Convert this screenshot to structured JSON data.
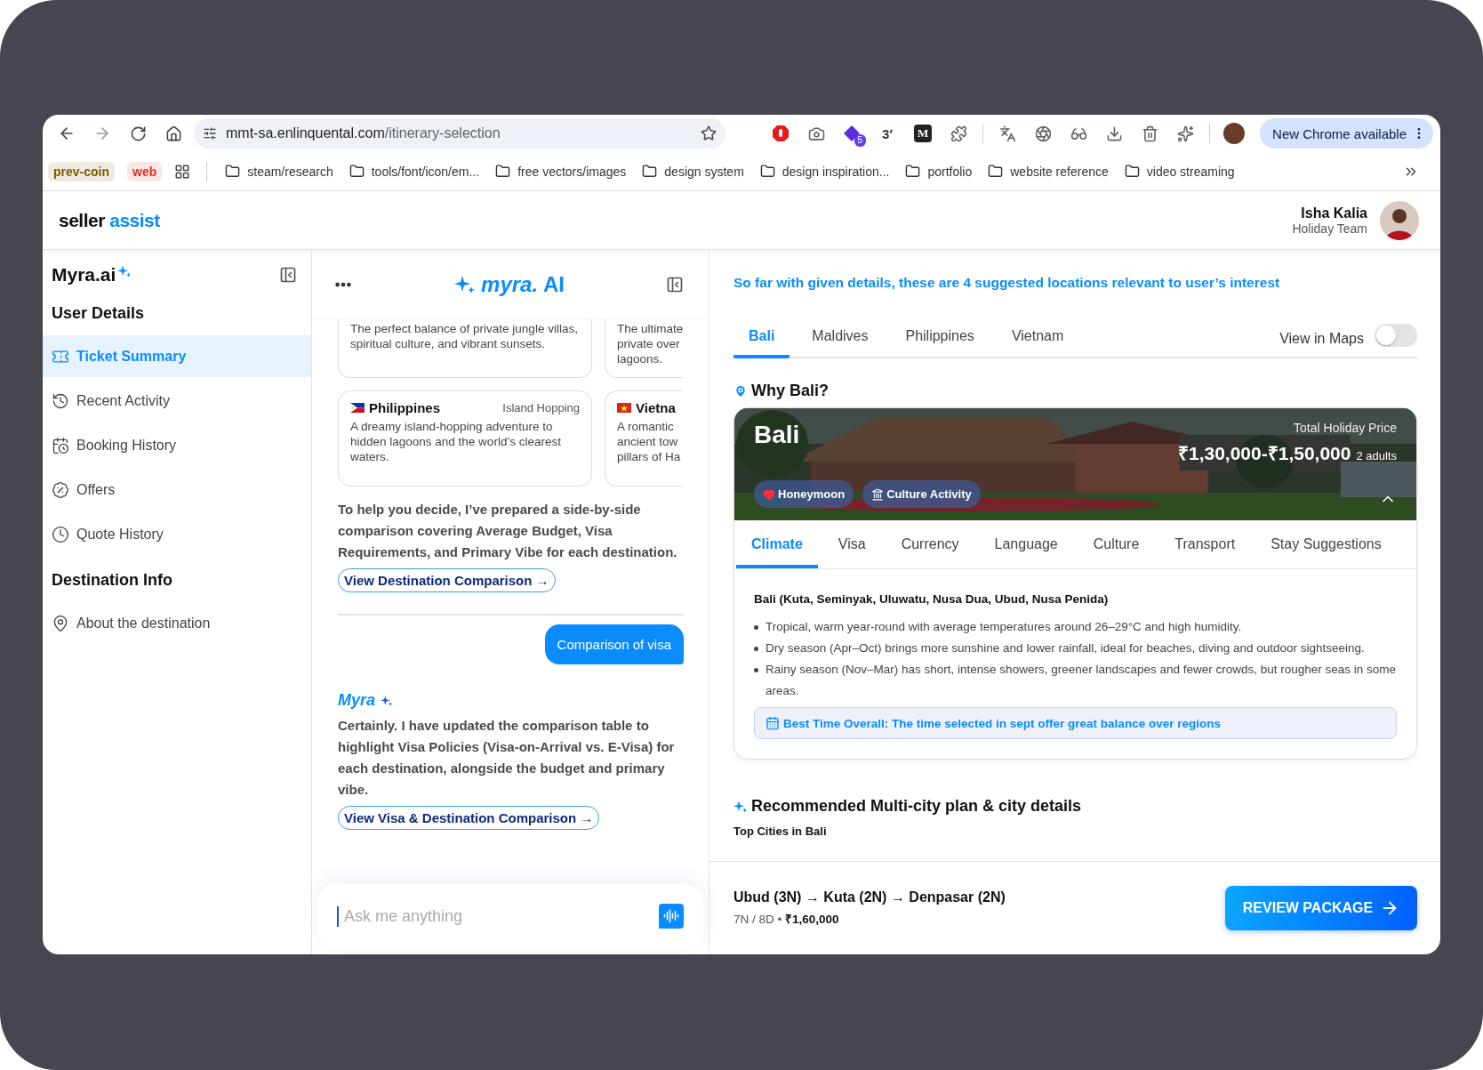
{
  "browser": {
    "url_host": "mmt-sa.enlinquental.com",
    "url_path": "/itinerary-selection",
    "extension_badge": "5",
    "extension_text": "3′",
    "extension_letter": "M",
    "update_button": "New Chrome available",
    "bookmark_chips": [
      {
        "label": "prev-coin",
        "color": "#7a5c00"
      },
      {
        "label": "web",
        "color": "#d93025"
      }
    ],
    "bookmarks": [
      "steam/research",
      "tools/font/icon/em...",
      "free vectors/images",
      "design system",
      "design inspiration...",
      "portfolio",
      "website reference",
      "video streaming"
    ]
  },
  "header": {
    "logo_main": "seller",
    "logo_accent": "assist",
    "user_name": "Isha Kalia",
    "user_team": "Holiday Team"
  },
  "sidebar": {
    "title": "Myra.ai",
    "sections": [
      {
        "title": "User Details",
        "items": [
          {
            "label": "Ticket Summary",
            "selected": true
          },
          {
            "label": "Recent Activity",
            "selected": false
          },
          {
            "label": "Booking History",
            "selected": false
          },
          {
            "label": "Offers",
            "selected": false
          },
          {
            "label": "Quote History",
            "selected": false
          }
        ]
      },
      {
        "title": "Destination Info",
        "items": [
          {
            "label": "About the destination",
            "selected": false
          }
        ]
      }
    ]
  },
  "chat": {
    "logo": "*myra.* AI",
    "card_rows": [
      [
        {
          "kind": "cut-top",
          "description": "The perfect balance of private jungle villas, spiritual culture, and vibrant sunsets."
        },
        {
          "kind": "cut-top-right",
          "description": "The ultimate\nprivate over\nlagoons."
        }
      ],
      [
        {
          "kind": "full",
          "name": "Philippines",
          "tag": "Island Hopping",
          "description": "A dreamy island-hopping adventure to hidden lagoons and the world’s clearest waters."
        },
        {
          "kind": "cut-right",
          "name": "Vietna",
          "description": "A romantic\nancient tow\npillars of Ha"
        }
      ]
    ],
    "messages": [
      {
        "kind": "bot",
        "text": "To help you decide, I’ve prepared a side-by-side comparison covering Average Budget, Visa Requirements, and Primary Vibe for each destination.",
        "link": "View Destination Comparison →"
      },
      {
        "kind": "user",
        "text": "Comparison of visa"
      },
      {
        "kind": "bot",
        "author": "Myra",
        "text": "Certainly. I have updated the comparison table to highlight Visa Policies (Visa-on-Arrival vs. E-Visa) for each destination, alongside the budget and primary vibe.",
        "link": "View Visa & Destination Comparison →"
      }
    ],
    "input": {
      "placeholder": "Ask me anything"
    }
  },
  "details": {
    "intro": "So far with given details, these are 4 suggested locations relevant to user’s interest",
    "destination_tabs": [
      {
        "label": "Bali",
        "selected": true
      },
      {
        "label": "Maldives",
        "selected": false
      },
      {
        "label": "Philippines",
        "selected": false
      },
      {
        "label": "Vietnam",
        "selected": false
      }
    ],
    "maps_toggle": {
      "label": "View in Maps",
      "on": false
    },
    "why_title": "Why Bali?",
    "hero": {
      "kind": "picture",
      "name": "Bali",
      "tags": [
        {
          "label": "Honeymoon"
        },
        {
          "label": "Culture Activity"
        }
      ],
      "price_label": "Total Holiday Price",
      "price": "₹1,30,000-₹1,50,000",
      "pax": "2 adults"
    },
    "info_tabs": [
      {
        "label": "Climate",
        "selected": true
      },
      {
        "label": "Visa",
        "selected": false
      },
      {
        "label": "Currency",
        "selected": false
      },
      {
        "label": "Language",
        "selected": false
      },
      {
        "label": "Culture",
        "selected": false
      },
      {
        "label": "Transport",
        "selected": false
      },
      {
        "label": "Stay Suggestions",
        "selected": false
      }
    ],
    "climate": {
      "heading": "Bali (Kuta, Seminyak, Uluwatu, Nusa Dua, Ubud, Nusa Penida)",
      "bullets": [
        "Tropical, warm year-round with average temperatures around 26–29°C and high humidity.",
        "Dry season (Apr–Oct) brings more sunshine and lower rainfall, ideal for beaches, diving and outdoor sightseeing.",
        "Rainy season (Nov–Mar) has short, intense showers, greener landscapes and fewer crowds, but rougher seas in some areas."
      ],
      "note": "Best Time Overall: The time selected in sept offer great balance over regions"
    },
    "plan_title": "Recommended Multi-city plan & city details",
    "plan_subtitle": "Top Cities in Bali"
  },
  "footer": {
    "route": "Ubud (3N) → Kuta (2N) → Denpasar (2N)",
    "meta": "7N / 8D • **₹1,60,000**",
    "button": "REVIEW PACKAGE"
  }
}
